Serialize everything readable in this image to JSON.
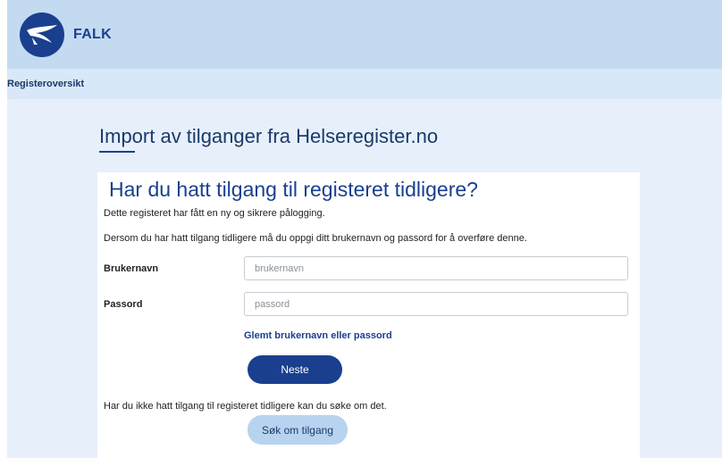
{
  "header": {
    "brand": "FALK"
  },
  "nav": {
    "registry_overview": "Registeroversikt"
  },
  "page": {
    "title": "Import av tilganger fra Helseregister.no"
  },
  "card": {
    "heading": "Har du hatt tilgang til registeret tidligere?",
    "intro": "Dette registeret har fått en ny og sikrere pålogging.",
    "instruction": "Dersom du har hatt tilgang tidligere må du oppgi ditt brukernavn og passord for å overføre denne.",
    "username": {
      "label": "Brukernavn",
      "value": "",
      "placeholder": "brukernavn"
    },
    "password": {
      "label": "Passord",
      "value": "",
      "placeholder": "passord"
    },
    "forgot_link": "Glemt brukernavn eller passord",
    "next_button": "Neste",
    "no_access_text": "Har du ikke hatt tilgang til registeret tidligere kan du søke om det.",
    "apply_button": "Søk om tilgang"
  },
  "colors": {
    "primary": "#1a3f8f",
    "header_bg": "#c4daf0",
    "nav_bg": "#d8e8f8",
    "content_bg": "#e7f0fa",
    "secondary_button": "#b7d3ef"
  },
  "icons": {
    "logo": "falk-bird-logo-icon"
  }
}
